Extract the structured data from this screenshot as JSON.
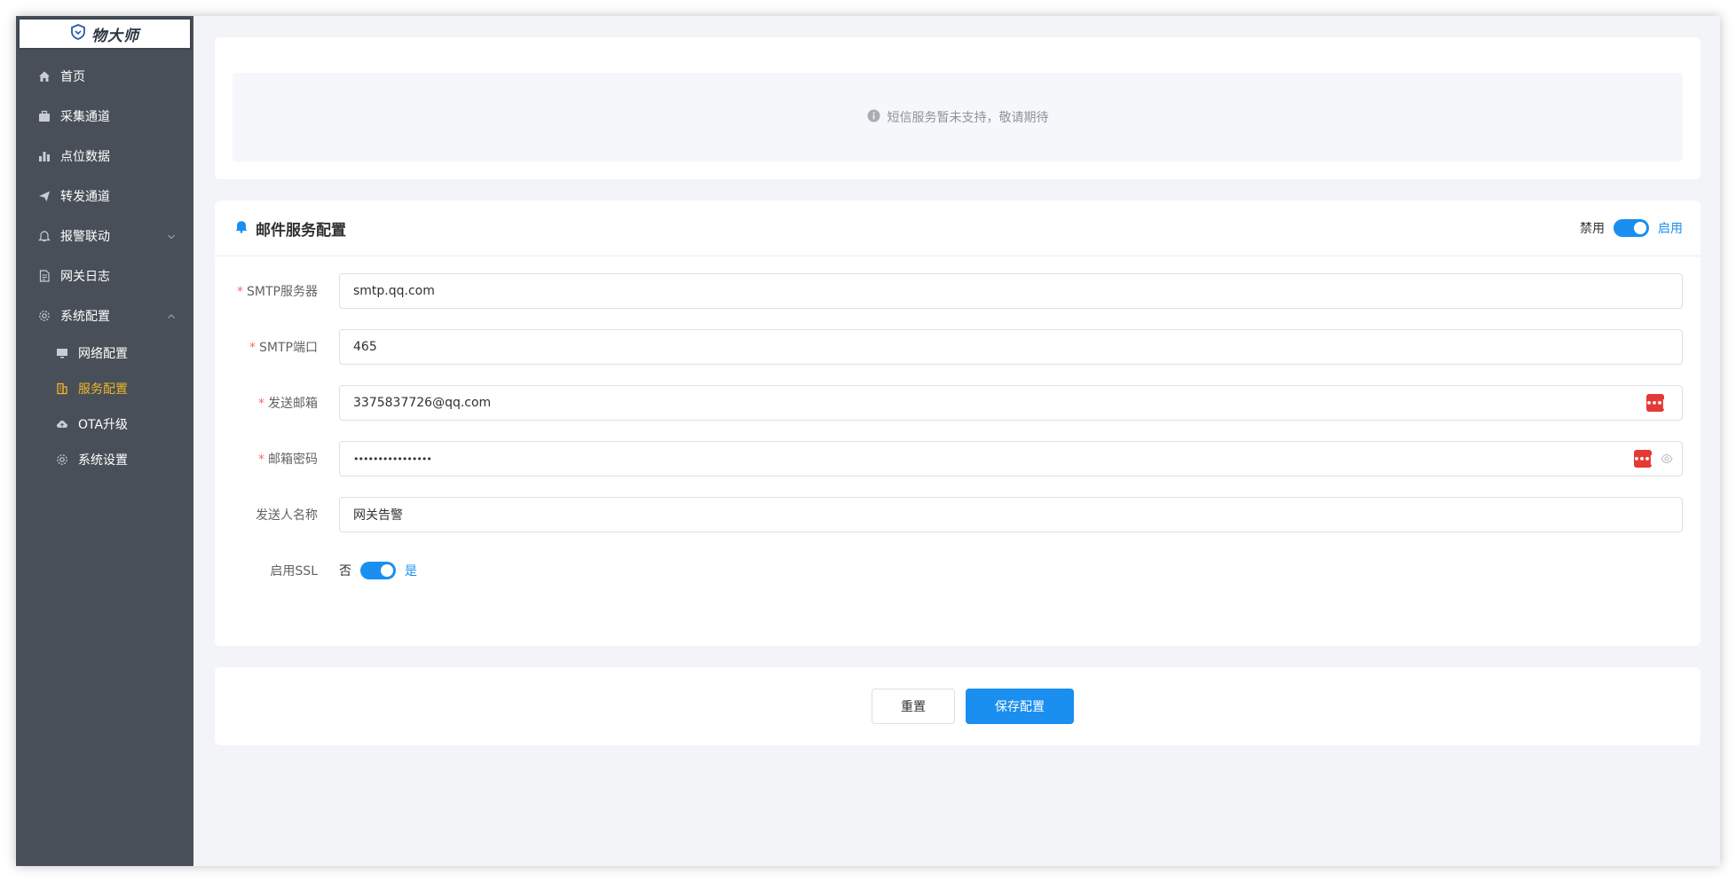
{
  "app": {
    "logo_text": "物大师"
  },
  "sidebar": {
    "items": [
      {
        "label": "首页",
        "icon": "home-icon"
      },
      {
        "label": "采集通道",
        "icon": "briefcase-icon"
      },
      {
        "label": "点位数据",
        "icon": "bar-chart-icon"
      },
      {
        "label": "转发通道",
        "icon": "send-icon"
      },
      {
        "label": "报警联动",
        "icon": "bell-icon"
      },
      {
        "label": "网关日志",
        "icon": "document-icon"
      },
      {
        "label": "系统配置",
        "icon": "gear-icon"
      }
    ],
    "sub_items": [
      {
        "label": "网络配置",
        "icon": "monitor-icon"
      },
      {
        "label": "服务配置",
        "icon": "building-icon",
        "active": true
      },
      {
        "label": "OTA升级",
        "icon": "cloud-upload-icon"
      },
      {
        "label": "系统设置",
        "icon": "gear-icon"
      }
    ]
  },
  "notice": {
    "text": "短信服务暂未支持，敬请期待"
  },
  "email": {
    "title": "邮件服务配置",
    "switch_off_label": "禁用",
    "switch_on_label": "启用",
    "fields": {
      "smtp_server": {
        "label": "SMTP服务器",
        "value": "smtp.qq.com"
      },
      "smtp_port": {
        "label": "SMTP端口",
        "value": "465"
      },
      "sender_email": {
        "label": "发送邮箱",
        "value": "3375837726@qq.com"
      },
      "password": {
        "label": "邮箱密码",
        "value": "••••••••••••••••"
      },
      "sender_name": {
        "label": "发送人名称",
        "value": "网关告警"
      },
      "ssl": {
        "label": "启用SSL",
        "off_label": "否",
        "on_label": "是"
      }
    },
    "required_mark": "*"
  },
  "actions": {
    "reset_label": "重置",
    "save_label": "保存配置"
  },
  "colors": {
    "accent": "#1a8ff0",
    "sidebar_bg": "#484f58",
    "active_nav": "#f0b429",
    "required": "#f56c6c",
    "badge": "#e53935"
  }
}
